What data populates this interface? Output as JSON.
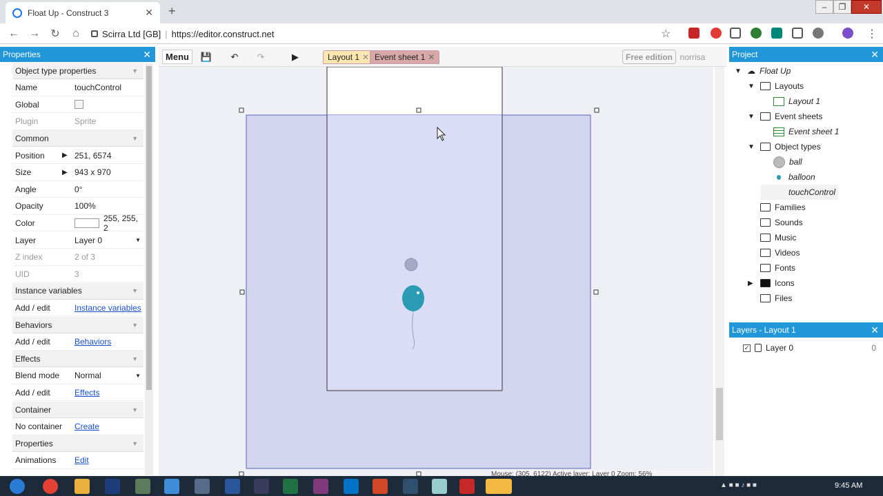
{
  "browser": {
    "tab_title": "Float Up - Construct 3",
    "url_org": "Scirra Ltd [GB]",
    "url": "https://editor.construct.net"
  },
  "properties": {
    "title": "Properties",
    "rows": [
      {
        "k": "Object type properties",
        "sec": true
      },
      {
        "k": "Name",
        "v": "touchControl"
      },
      {
        "k": "Global",
        "v": ""
      },
      {
        "k": "Plugin",
        "v": "Sprite",
        "dim": true
      },
      {
        "k": "Common",
        "sec": true
      },
      {
        "k": "Position",
        "v": "251, 6574",
        "arrow": true
      },
      {
        "k": "Size",
        "v": "943 x 970",
        "arrow": true
      },
      {
        "k": "Angle",
        "v": "0°"
      },
      {
        "k": "Opacity",
        "v": "100%"
      },
      {
        "k": "Color",
        "v": "255, 255, 2"
      },
      {
        "k": "Layer",
        "v": "Layer 0"
      },
      {
        "k": "Z index",
        "v": "2 of 3",
        "dim": true
      },
      {
        "k": "UID",
        "v": "3",
        "dim": true
      },
      {
        "k": "Instance variables",
        "sec": true
      },
      {
        "k": "Add / edit",
        "v": "Instance variables",
        "link": true
      },
      {
        "k": "Behaviors",
        "sec": true
      },
      {
        "k": "Add / edit",
        "v": "Behaviors",
        "link": true
      },
      {
        "k": "Effects",
        "sec": true
      },
      {
        "k": "Blend mode",
        "v": "Normal"
      },
      {
        "k": "Add / edit",
        "v": "Effects",
        "link": true
      },
      {
        "k": "Container",
        "sec": true
      },
      {
        "k": "No container",
        "v": "Create",
        "link": true
      },
      {
        "k": "Properties",
        "sec": true
      },
      {
        "k": "Animations",
        "v": "Edit",
        "link": true
      }
    ]
  },
  "toolbar": {
    "menu": "Menu",
    "tab_layout": "Layout 1",
    "tab_events": "Event sheet 1",
    "edition": "Free edition",
    "user": "norrisa"
  },
  "project": {
    "title": "Project",
    "items": [
      {
        "label": "Float Up",
        "x": 0,
        "italic": true
      },
      {
        "label": "Layouts",
        "x": 1
      },
      {
        "label": "Layout 1",
        "x": 2,
        "italic": true
      },
      {
        "label": "Event sheets",
        "x": 1
      },
      {
        "label": "Event sheet 1",
        "x": 2,
        "italic": true
      },
      {
        "label": "Object types",
        "x": 1
      },
      {
        "label": "ball",
        "x": 2,
        "italic": true
      },
      {
        "label": "balloon",
        "x": 2,
        "italic": true
      },
      {
        "label": "touchControl",
        "x": 2,
        "italic": true
      },
      {
        "label": "Families",
        "x": 1
      },
      {
        "label": "Sounds",
        "x": 1
      },
      {
        "label": "Music",
        "x": 1
      },
      {
        "label": "Videos",
        "x": 1
      },
      {
        "label": "Fonts",
        "x": 1
      },
      {
        "label": "Icons",
        "x": 1
      },
      {
        "label": "Files",
        "x": 1
      }
    ]
  },
  "layers": {
    "title": "Layers - Layout 1",
    "layer_name": "Layer 0",
    "layer_count": "0"
  },
  "status": {
    "text": "Mouse: (305, 6122)    Active layer: Layer 0    Zoom: 56%"
  },
  "taskbar": {
    "time": "9:45 AM"
  },
  "colors": {
    "accent": "#2196d9",
    "selection": "#c9cbe9",
    "balloon": "#2a9bb3"
  }
}
